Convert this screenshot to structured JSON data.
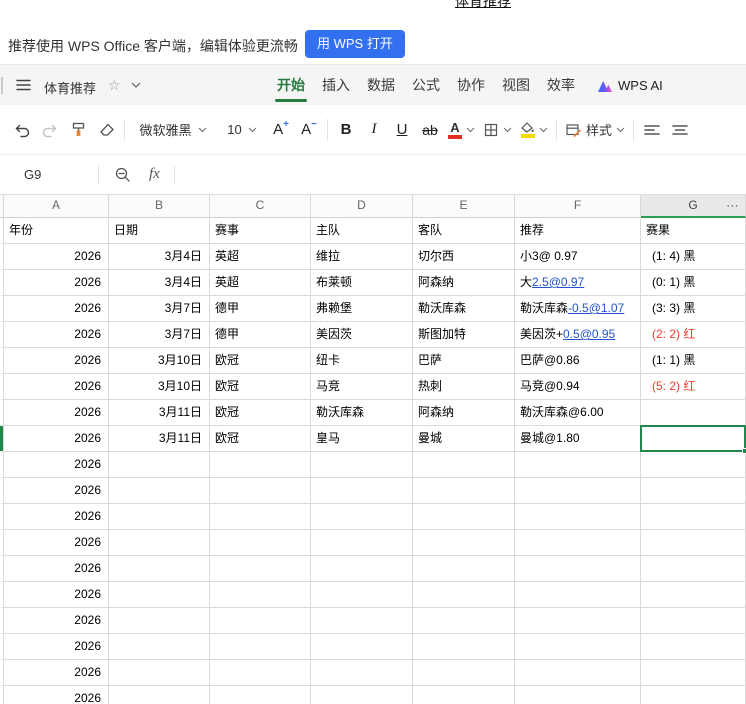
{
  "page": {
    "clipped_title": "体育推荐"
  },
  "banner": {
    "text": "推荐使用 WPS Office 客户端，编辑体验更流畅",
    "open_button": "用 WPS 打开"
  },
  "menubar": {
    "doc_title": "体育推荐",
    "tabs": [
      "开始",
      "插入",
      "数据",
      "公式",
      "协作",
      "视图",
      "效率"
    ],
    "active_tab": "开始",
    "wps_ai_label": "WPS AI"
  },
  "toolbar": {
    "font_name": "微软雅黑",
    "font_size": "10",
    "bold": "B",
    "italic": "I",
    "underline": "U",
    "strikethrough": "ab",
    "font_color_letter": "A",
    "grow_letter": "A",
    "grow_sign": "+",
    "shrink_letter": "A",
    "shrink_sign": "−",
    "style_label": "样式"
  },
  "formula_bar": {
    "name_box": "G9",
    "fx_label": "fx",
    "formula_value": ""
  },
  "grid": {
    "column_letters": [
      "A",
      "B",
      "C",
      "D",
      "E",
      "F",
      "G"
    ],
    "more_columns_glyph": "⋯",
    "header_row": [
      "年份",
      "日期",
      "赛事",
      "主队",
      "客队",
      "推荐",
      "赛果"
    ],
    "rows": [
      {
        "year": "2026",
        "date": "3月4日",
        "league": "英超",
        "home": "维拉",
        "away": "切尔西",
        "tip": [
          {
            "text": "小3@ 0.97",
            "link": false
          }
        ],
        "result": "(1: 4) 黑",
        "red": false,
        "selected_cell": ""
      },
      {
        "year": "2026",
        "date": "3月4日",
        "league": "英超",
        "home": "布莱顿",
        "away": "阿森纳",
        "tip": [
          {
            "text": "大",
            "link": false
          },
          {
            "text": "2.5@0.97",
            "link": true
          }
        ],
        "result": "(0: 1) 黑",
        "red": false,
        "selected_cell": ""
      },
      {
        "year": "2026",
        "date": "3月7日",
        "league": "德甲",
        "home": "弗赖堡",
        "away": "勒沃库森",
        "tip": [
          {
            "text": "勒沃库森",
            "link": false
          },
          {
            "text": "-0.5@1.07",
            "link": true
          }
        ],
        "result": "(3: 3) 黑",
        "red": false,
        "selected_cell": ""
      },
      {
        "year": "2026",
        "date": "3月7日",
        "league": "德甲",
        "home": "美因茨",
        "away": "斯图加特",
        "tip": [
          {
            "text": "美因茨+",
            "link": false
          },
          {
            "text": "0.5@0.95",
            "link": true
          }
        ],
        "result": "(2: 2) 红",
        "red": true,
        "selected_cell": ""
      },
      {
        "year": "2026",
        "date": "3月10日",
        "league": "欧冠",
        "home": "纽卡",
        "away": "巴萨",
        "tip": [
          {
            "text": "巴萨@0.86",
            "link": false
          }
        ],
        "result": "(1: 1) 黑",
        "red": false,
        "selected_cell": ""
      },
      {
        "year": "2026",
        "date": "3月10日",
        "league": "欧冠",
        "home": "马竞",
        "away": "热刺",
        "tip": [
          {
            "text": "马竞@0.94",
            "link": false
          }
        ],
        "result": "(5: 2) 红",
        "red": true,
        "selected_cell": ""
      },
      {
        "year": "2026",
        "date": "3月11日",
        "league": "欧冠",
        "home": "勒沃库森",
        "away": "阿森纳",
        "tip": [
          {
            "text": "勒沃库森@6.00",
            "link": false
          }
        ],
        "result": "",
        "red": false,
        "selected_cell": ""
      },
      {
        "year": "2026",
        "date": "3月11日",
        "league": "欧冠",
        "home": "皇马",
        "away": "曼城",
        "tip": [
          {
            "text": "曼城@1.80",
            "link": false
          }
        ],
        "result": "",
        "red": false,
        "selected_cell": "G"
      }
    ],
    "filler_year": "2026",
    "filler_row_count": 10,
    "selected_cell_ref": "G9"
  },
  "colors": {
    "accent_blue": "#3370F0",
    "tab_green": "#267C3E",
    "selection_green": "#21874B",
    "header_underline_green": "#2AA052",
    "link_blue": "#2255CC",
    "result_red": "#F23C30"
  }
}
